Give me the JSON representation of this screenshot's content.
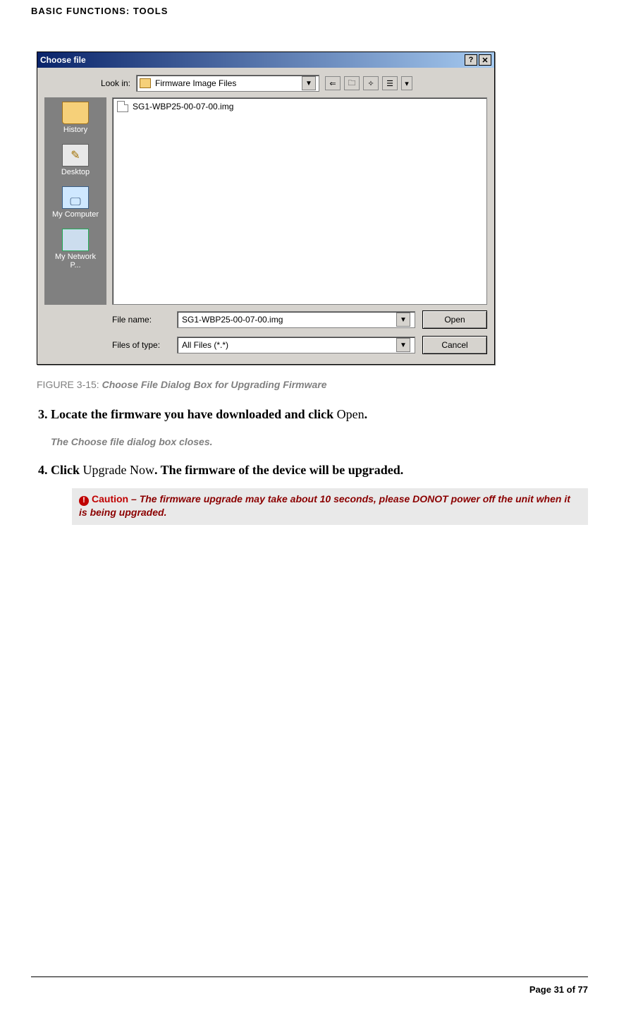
{
  "header": "BASIC FUNCTIONS: TOOLS",
  "dialog": {
    "title": "Choose file",
    "help_glyph": "?",
    "close_glyph": "✕",
    "look_in_label": "Look in:",
    "look_in_value": "Firmware Image Files",
    "nav_icons": {
      "back": "⇐",
      "up": "🗀",
      "newfolder": "✧",
      "viewmenu": "☰",
      "viewdd": "▾"
    },
    "places": [
      {
        "id": "history",
        "label": "History"
      },
      {
        "id": "desktop",
        "label": "Desktop"
      },
      {
        "id": "mycomp",
        "label": "My Computer"
      },
      {
        "id": "mynet",
        "label": "My Network P..."
      }
    ],
    "file_item": "SG1-WBP25-00-07-00.img",
    "file_name_label": "File name:",
    "file_name_value": "SG1-WBP25-00-07-00.img",
    "file_type_label": "Files of type:",
    "file_type_value": "All Files (*.*)",
    "open_btn": "Open",
    "cancel_btn": "Cancel",
    "dropdown_glyph": "▼"
  },
  "figure": {
    "prefix": "FIGURE 3-15: ",
    "caption": "Choose File Dialog Box for Upgrading Firmware"
  },
  "step3": {
    "num": "3.",
    "bold_a": "Locate the firmware you have downloaded and click ",
    "plain": "Open",
    "bold_b": "."
  },
  "close_line": "The Choose file dialog box closes.",
  "step4": {
    "num": "4.",
    "bold_a": "Click ",
    "plain": "Upgrade Now",
    "bold_b": ". The firmware of the device will be upgraded."
  },
  "caution": {
    "bang": "!",
    "word": "Caution",
    "dash": " – ",
    "text": "The firmware upgrade may take about 10 seconds, please DONOT power off the unit when it is being upgraded."
  },
  "footer": "Page 31 of 77"
}
